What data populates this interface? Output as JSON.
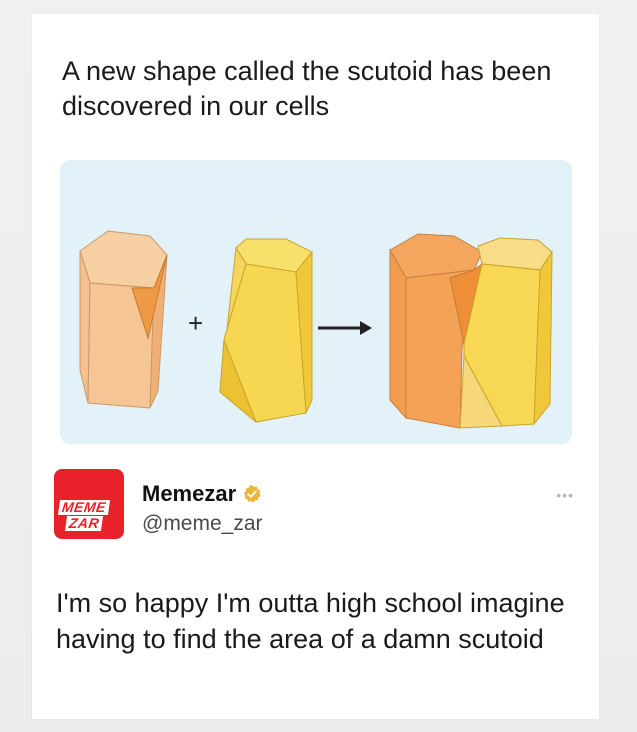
{
  "headline": "A new shape called the scutoid has been discovered in our cells",
  "illustration": {
    "plus_symbol": "+",
    "arrow_symbol": "→"
  },
  "author": {
    "avatar_line1": "MEME",
    "avatar_line2": "ZAR",
    "display_name": "Memezar",
    "handle": "@meme_zar",
    "verified_icon": "verified-badge-icon",
    "more_label": "•••"
  },
  "tweet_text": "I'm so happy I'm outta high school imagine having to find the area of a damn scutoid",
  "colors": {
    "illustration_bg": "#e3f1f8",
    "orange_shape": "#f5b27a",
    "yellow_shape": "#f7d24a",
    "avatar_red": "#e8212a",
    "verified_gold": "#e9b53a"
  }
}
